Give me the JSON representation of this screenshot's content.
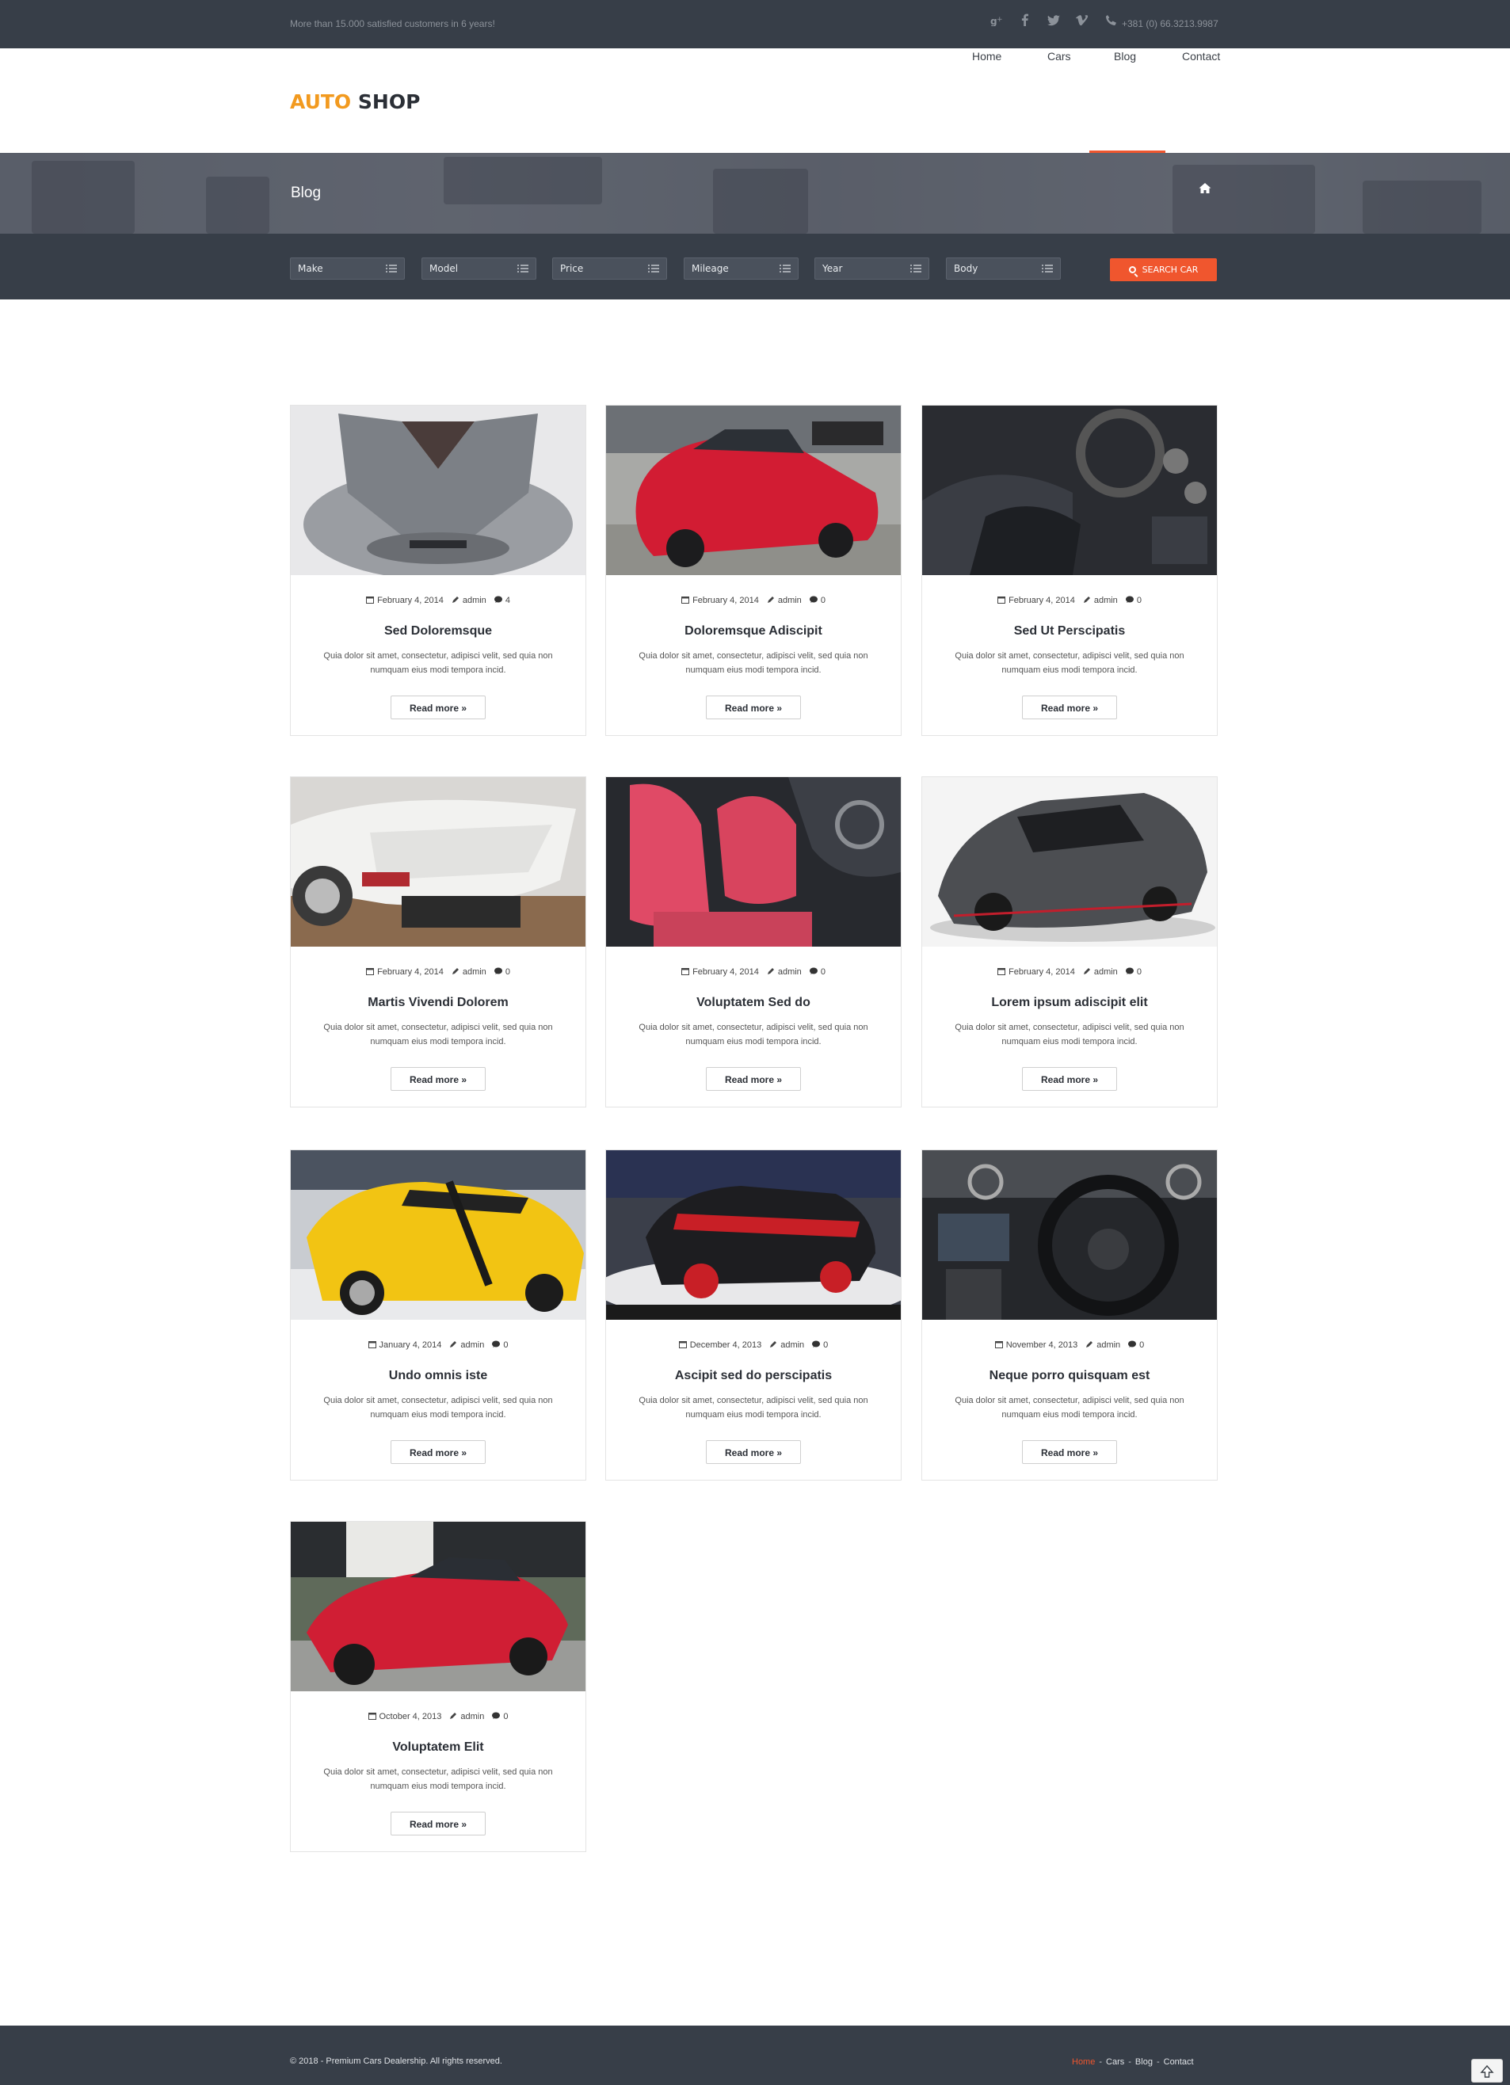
{
  "topbar": {
    "tagline": "More than 15.000 satisfied customers in 6 years!",
    "social_icons": [
      "google-plus-icon",
      "facebook-icon",
      "twitter-icon",
      "vimeo-icon"
    ],
    "phone": "+381 (0) 66.3213.9987"
  },
  "brand": {
    "part1": "AUTO",
    "part2": "SHOP",
    "colors": {
      "accent": "#f29a1f",
      "dark": "#2b2f36"
    }
  },
  "nav": {
    "items": [
      "Home",
      "Cars",
      "Blog",
      "Contact"
    ],
    "active": "Blog",
    "active_color": "#f0562e"
  },
  "page": {
    "title": "Blog"
  },
  "search": {
    "filters": [
      "Make",
      "Model",
      "Price",
      "Mileage",
      "Year",
      "Body"
    ],
    "button_label": "SEARCH CAR",
    "button_color": "#f0562e"
  },
  "posts": [
    {
      "date": "February 4, 2014",
      "author": "admin",
      "comments": "4",
      "title": "Sed Doloremsque",
      "excerpt": "Quia dolor sit amet, consectetur, adipisci velit, sed quia non numquam eius modi tempora incid.",
      "more": "Read more »"
    },
    {
      "date": "February 4, 2014",
      "author": "admin",
      "comments": "0",
      "title": "Doloremsque Adiscipit",
      "excerpt": "Quia dolor sit amet, consectetur, adipisci velit, sed quia non numquam eius modi tempora incid.",
      "more": "Read more »"
    },
    {
      "date": "February 4, 2014",
      "author": "admin",
      "comments": "0",
      "title": "Sed Ut Perscipatis",
      "excerpt": "Quia dolor sit amet, consectetur, adipisci velit, sed quia non numquam eius modi tempora incid.",
      "more": "Read more »"
    },
    {
      "date": "February 4, 2014",
      "author": "admin",
      "comments": "0",
      "title": "Martis Vivendi Dolorem",
      "excerpt": "Quia dolor sit amet, consectetur, adipisci velit, sed quia non numquam eius modi tempora incid.",
      "more": "Read more »"
    },
    {
      "date": "February 4, 2014",
      "author": "admin",
      "comments": "0",
      "title": "Voluptatem Sed do",
      "excerpt": "Quia dolor sit amet, consectetur, adipisci velit, sed quia non numquam eius modi tempora incid.",
      "more": "Read more »"
    },
    {
      "date": "February 4, 2014",
      "author": "admin",
      "comments": "0",
      "title": "Lorem ipsum adiscipit elit",
      "excerpt": "Quia dolor sit amet, consectetur, adipisci velit, sed quia non numquam eius modi tempora incid.",
      "more": "Read more »"
    },
    {
      "date": "January 4, 2014",
      "author": "admin",
      "comments": "0",
      "title": "Undo omnis iste",
      "excerpt": "Quia dolor sit amet, consectetur, adipisci velit, sed quia non numquam eius modi tempora incid.",
      "more": "Read more »"
    },
    {
      "date": "December 4, 2013",
      "author": "admin",
      "comments": "0",
      "title": "Ascipit sed do perscipatis",
      "excerpt": "Quia dolor sit amet, consectetur, adipisci velit, sed quia non numquam eius modi tempora incid.",
      "more": "Read more »"
    },
    {
      "date": "November 4, 2013",
      "author": "admin",
      "comments": "0",
      "title": "Neque porro quisquam est",
      "excerpt": "Quia dolor sit amet, consectetur, adipisci velit, sed quia non numquam eius modi tempora incid.",
      "more": "Read more »"
    },
    {
      "date": "October 4, 2013",
      "author": "admin",
      "comments": "0",
      "title": "Voluptatem Elit",
      "excerpt": "Quia dolor sit amet, consectetur, adipisci velit, sed quia non numquam eius modi tempora incid.",
      "more": "Read more »"
    }
  ],
  "footer": {
    "copyright": "© 2018 - Premium Cars Dealership. All rights reserved.",
    "links": [
      "Home",
      "Cars",
      "Blog",
      "Contact"
    ],
    "separator": "-"
  }
}
